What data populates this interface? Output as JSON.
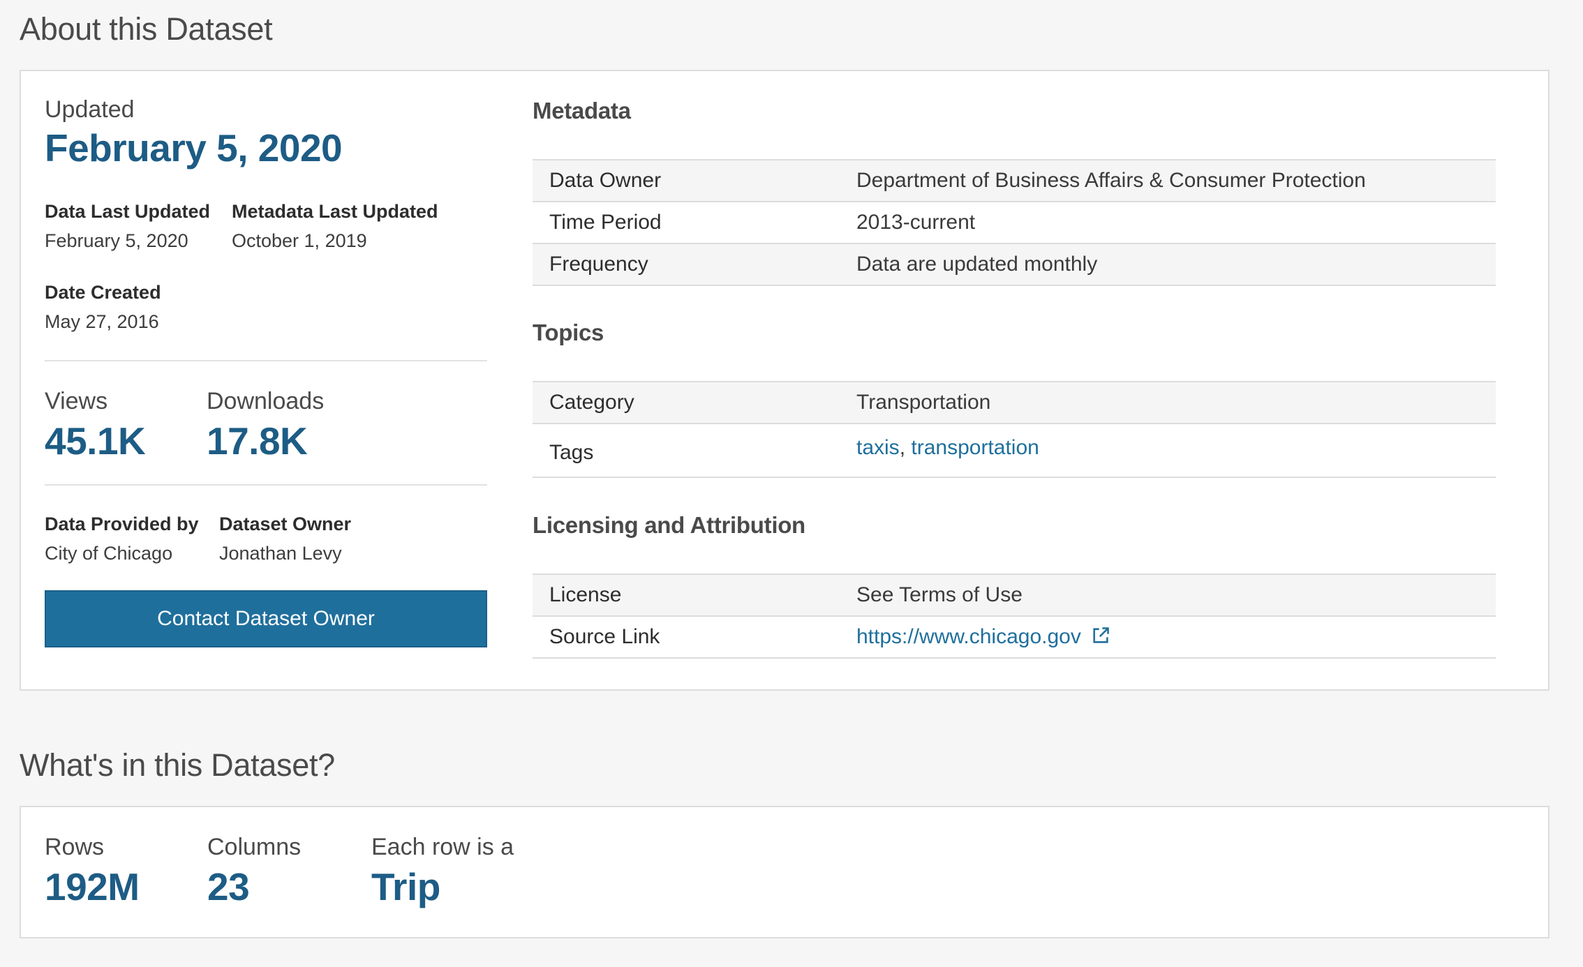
{
  "about": {
    "title": "About this Dataset",
    "updated_label": "Updated",
    "updated_date": "February 5, 2020",
    "data_last_updated_label": "Data Last Updated",
    "data_last_updated_value": "February 5, 2020",
    "metadata_last_updated_label": "Metadata Last Updated",
    "metadata_last_updated_value": "October 1, 2019",
    "date_created_label": "Date Created",
    "date_created_value": "May 27, 2016",
    "views_label": "Views",
    "views_value": "45.1K",
    "downloads_label": "Downloads",
    "downloads_value": "17.8K",
    "provided_by_label": "Data Provided by",
    "provided_by_value": "City of Chicago",
    "owner_label": "Dataset Owner",
    "owner_value": "Jonathan Levy",
    "contact_button": "Contact Dataset Owner"
  },
  "metadata": {
    "heading": "Metadata",
    "rows": [
      {
        "key": "Data Owner",
        "value": "Department of Business Affairs & Consumer Protection"
      },
      {
        "key": "Time Period",
        "value": "2013-current"
      },
      {
        "key": "Frequency",
        "value": "Data are updated monthly"
      }
    ]
  },
  "topics": {
    "heading": "Topics",
    "category_key": "Category",
    "category_value": "Transportation",
    "tags_key": "Tags",
    "tags": [
      "taxis",
      "transportation"
    ],
    "tag_separator": ","
  },
  "licensing": {
    "heading": "Licensing and Attribution",
    "license_key": "License",
    "license_value": "See Terms of Use",
    "source_key": "Source Link",
    "source_value": "https://www.chicago.gov",
    "source_icon": "external-link-icon"
  },
  "whats": {
    "title": "What's in this Dataset?",
    "rows_label": "Rows",
    "rows_value": "192M",
    "columns_label": "Columns",
    "columns_value": "23",
    "each_row_label": "Each row is a",
    "each_row_value": "Trip"
  },
  "colors": {
    "accent": "#1d5c85",
    "button": "#1f6f9c",
    "link": "#1f6f9c",
    "background": "#f6f6f6"
  }
}
